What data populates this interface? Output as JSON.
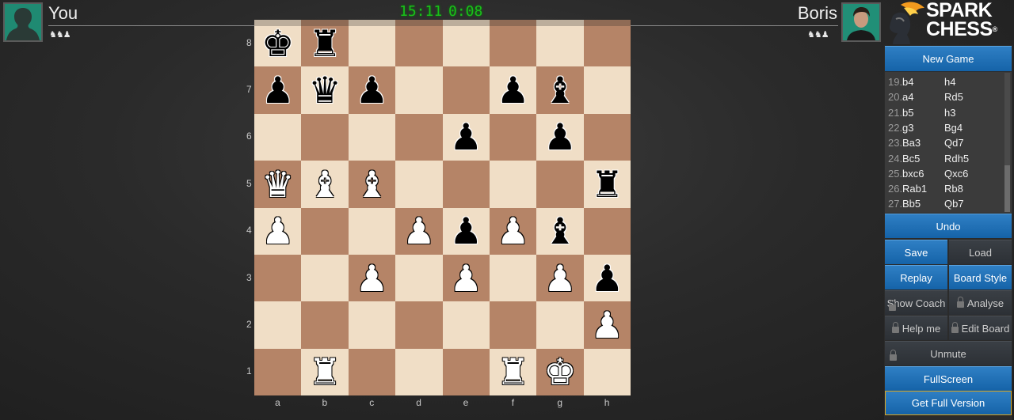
{
  "players": {
    "you": {
      "name": "You",
      "captured": "♞♞♟",
      "clock": "15:11",
      "avatar": "silhouette-avatar"
    },
    "opponent": {
      "name": "Boris",
      "captured": "♞♞♟",
      "clock": "0:08",
      "avatar": "boris-avatar"
    }
  },
  "logo": {
    "line1": "SPARK",
    "line2": "CHESS",
    "reg": "®"
  },
  "board": {
    "ranks": [
      "8",
      "7",
      "6",
      "5",
      "4",
      "3",
      "2",
      "1"
    ],
    "files": [
      "a",
      "b",
      "c",
      "d",
      "e",
      "f",
      "g",
      "h"
    ],
    "position": [
      [
        "bK",
        "bR",
        "",
        "",
        "",
        "",
        "",
        ""
      ],
      [
        "bP",
        "bQ",
        "bP",
        "",
        "",
        "bP",
        "bB",
        ""
      ],
      [
        "",
        "",
        "",
        "",
        "bP",
        "",
        "bP",
        ""
      ],
      [
        "wQ",
        "wB",
        "wB",
        "",
        "",
        "",
        "",
        "bR"
      ],
      [
        "wP",
        "",
        "",
        "wP",
        "bP",
        "wP",
        "bB",
        ""
      ],
      [
        "",
        "",
        "wP",
        "",
        "wP",
        "",
        "wP",
        "bP"
      ],
      [
        "",
        "",
        "",
        "",
        "",
        "",
        "",
        "wP"
      ],
      [
        "",
        "wR",
        "",
        "",
        "",
        "wR",
        "wK",
        ""
      ]
    ],
    "colors": {
      "light": "#f0dec6",
      "dark": "#b58467"
    }
  },
  "moves": [
    {
      "num": "19.",
      "white": "b4",
      "black": "h4"
    },
    {
      "num": "20.",
      "white": "a4",
      "black": "Rd5"
    },
    {
      "num": "21.",
      "white": "b5",
      "black": "h3"
    },
    {
      "num": "22.",
      "white": "g3",
      "black": "Bg4"
    },
    {
      "num": "23.",
      "white": "Ba3",
      "black": "Qd7"
    },
    {
      "num": "24.",
      "white": "Bc5",
      "black": "Rdh5"
    },
    {
      "num": "25.",
      "white": "bxc6",
      "black": "Qxc6"
    },
    {
      "num": "26.",
      "white": "Rab1",
      "black": "Rb8"
    },
    {
      "num": "27.",
      "white": "Bb5",
      "black": "Qb7"
    }
  ],
  "buttons": {
    "new_game": "New Game",
    "undo": "Undo",
    "save": "Save",
    "load": "Load",
    "replay": "Replay",
    "board_style": "Board Style",
    "show_coach": "Show Coach",
    "analyse": "Analyse",
    "help_me": "Help me",
    "edit_board": "Edit Board",
    "unmute": "Unmute",
    "fullscreen": "FullScreen",
    "get_full_version": "Get Full Version"
  },
  "colors": {
    "accent_blue": "#1f6fb5",
    "clock_green": "#19c019",
    "highlight_gold": "#d9a520"
  }
}
